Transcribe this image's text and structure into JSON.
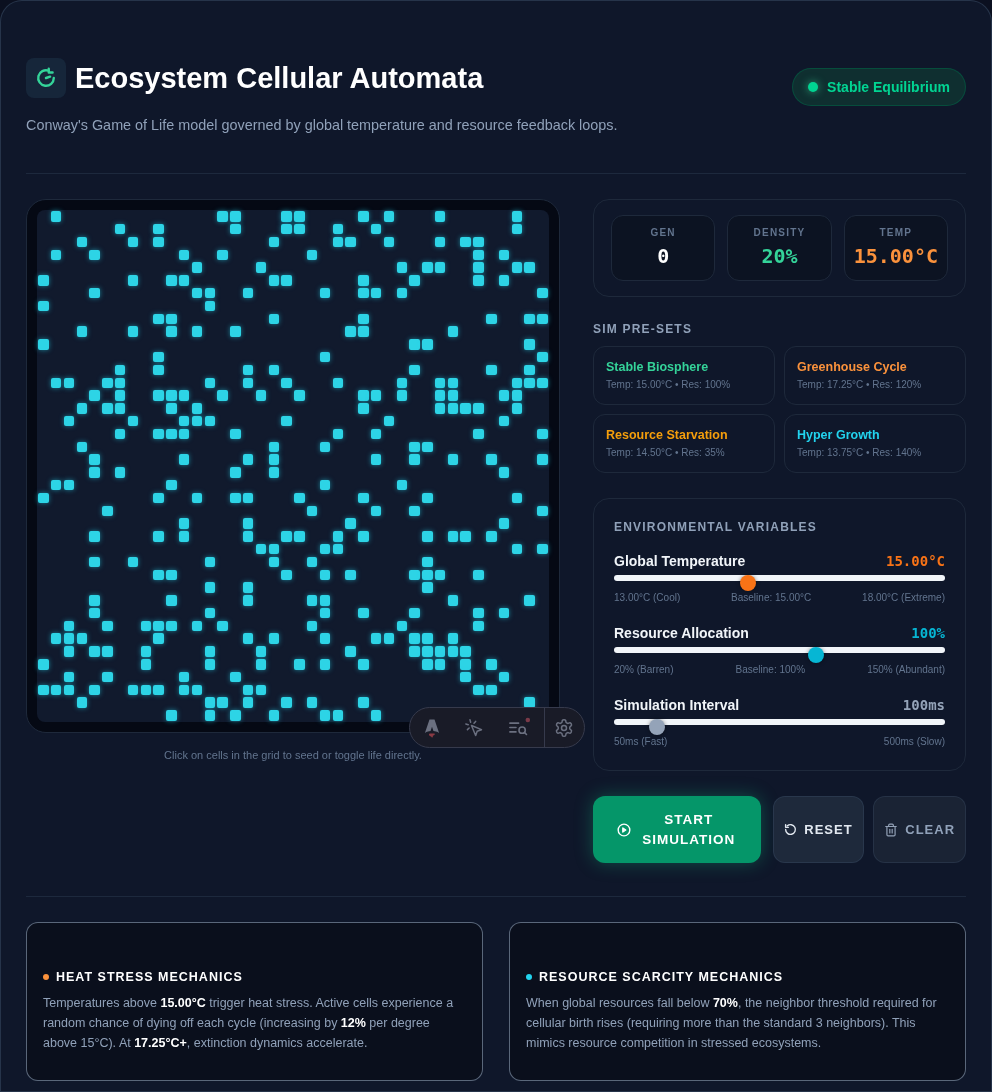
{
  "header": {
    "title": "Ecosystem Cellular Automata",
    "subtitle": "Conway's Game of Life model governed by global temperature and resource feedback loops.",
    "status_badge": {
      "label": "Stable Equilibrium"
    }
  },
  "grid": {
    "rows": [
      [
        false,
        true,
        false,
        false,
        false,
        false,
        false,
        false,
        false,
        false,
        false,
        false,
        false,
        false,
        true,
        true,
        false,
        false,
        false,
        true,
        true,
        false,
        false,
        false,
        false,
        true,
        false,
        true,
        false,
        false,
        false,
        true,
        false,
        false,
        false,
        false,
        false,
        true,
        false,
        false
      ],
      [
        false,
        false,
        false,
        false,
        false,
        false,
        true,
        false,
        false,
        true,
        false,
        false,
        false,
        false,
        false,
        true,
        false,
        false,
        false,
        true,
        true,
        false,
        false,
        true,
        false,
        false,
        true,
        false,
        false,
        false,
        false,
        false,
        false,
        false,
        false,
        false,
        false,
        true,
        false,
        false
      ],
      [
        false,
        false,
        false,
        true,
        false,
        false,
        false,
        true,
        false,
        true,
        false,
        false,
        false,
        false,
        false,
        false,
        false,
        false,
        true,
        false,
        false,
        false,
        false,
        true,
        true,
        false,
        false,
        true,
        false,
        false,
        false,
        true,
        false,
        true,
        true,
        false,
        false,
        false,
        false,
        false
      ],
      [
        false,
        true,
        false,
        false,
        true,
        false,
        false,
        false,
        false,
        false,
        false,
        true,
        false,
        false,
        true,
        false,
        false,
        false,
        false,
        false,
        false,
        true,
        false,
        false,
        false,
        false,
        false,
        false,
        false,
        false,
        false,
        false,
        false,
        false,
        true,
        false,
        true,
        false,
        false,
        false
      ],
      [
        false,
        false,
        false,
        false,
        false,
        false,
        false,
        false,
        false,
        false,
        false,
        false,
        true,
        false,
        false,
        false,
        false,
        true,
        false,
        false,
        false,
        false,
        false,
        false,
        false,
        false,
        false,
        false,
        true,
        false,
        true,
        true,
        false,
        false,
        true,
        false,
        false,
        true,
        true,
        false
      ],
      [
        true,
        false,
        false,
        false,
        false,
        false,
        false,
        true,
        false,
        false,
        true,
        true,
        false,
        false,
        false,
        false,
        false,
        false,
        true,
        true,
        false,
        false,
        false,
        false,
        false,
        true,
        false,
        false,
        false,
        true,
        false,
        false,
        false,
        false,
        true,
        false,
        true,
        false,
        false,
        false
      ],
      [
        false,
        false,
        false,
        false,
        true,
        false,
        false,
        false,
        false,
        false,
        false,
        false,
        true,
        true,
        false,
        false,
        true,
        false,
        false,
        false,
        false,
        false,
        true,
        false,
        false,
        true,
        true,
        false,
        true,
        false,
        false,
        false,
        false,
        false,
        false,
        false,
        false,
        false,
        false,
        true
      ],
      [
        true,
        false,
        false,
        false,
        false,
        false,
        false,
        false,
        false,
        false,
        false,
        false,
        false,
        true,
        false,
        false,
        false,
        false,
        false,
        false,
        false,
        false,
        false,
        false,
        false,
        false,
        false,
        false,
        false,
        false,
        false,
        false,
        false,
        false,
        false,
        false,
        false,
        false,
        false,
        false
      ],
      [
        false,
        false,
        false,
        false,
        false,
        false,
        false,
        false,
        false,
        true,
        true,
        false,
        false,
        false,
        false,
        false,
        false,
        false,
        true,
        false,
        false,
        false,
        false,
        false,
        false,
        true,
        false,
        false,
        false,
        false,
        false,
        false,
        false,
        false,
        false,
        true,
        false,
        false,
        true,
        true
      ],
      [
        false,
        false,
        false,
        true,
        false,
        false,
        false,
        true,
        false,
        false,
        true,
        false,
        true,
        false,
        false,
        true,
        false,
        false,
        false,
        false,
        false,
        false,
        false,
        false,
        true,
        true,
        false,
        false,
        false,
        false,
        false,
        false,
        true,
        false,
        false,
        false,
        false,
        false,
        false,
        false
      ],
      [
        true,
        false,
        false,
        false,
        false,
        false,
        false,
        false,
        false,
        false,
        false,
        false,
        false,
        false,
        false,
        false,
        false,
        false,
        false,
        false,
        false,
        false,
        false,
        false,
        false,
        false,
        false,
        false,
        false,
        true,
        true,
        false,
        false,
        false,
        false,
        false,
        false,
        false,
        true,
        false
      ],
      [
        false,
        false,
        false,
        false,
        false,
        false,
        false,
        false,
        false,
        true,
        false,
        false,
        false,
        false,
        false,
        false,
        false,
        false,
        false,
        false,
        false,
        false,
        true,
        false,
        false,
        false,
        false,
        false,
        false,
        false,
        false,
        false,
        false,
        false,
        false,
        false,
        false,
        false,
        false,
        true
      ],
      [
        false,
        false,
        false,
        false,
        false,
        false,
        true,
        false,
        false,
        true,
        false,
        false,
        false,
        false,
        false,
        false,
        true,
        false,
        true,
        false,
        false,
        false,
        false,
        false,
        false,
        false,
        false,
        false,
        false,
        true,
        false,
        false,
        false,
        false,
        false,
        true,
        false,
        false,
        true,
        false
      ],
      [
        false,
        true,
        true,
        false,
        false,
        true,
        true,
        false,
        false,
        false,
        false,
        false,
        false,
        true,
        false,
        false,
        true,
        false,
        false,
        true,
        false,
        false,
        false,
        true,
        false,
        false,
        false,
        false,
        true,
        false,
        false,
        true,
        true,
        false,
        false,
        false,
        false,
        true,
        true,
        true
      ],
      [
        false,
        false,
        false,
        false,
        true,
        false,
        true,
        false,
        false,
        true,
        true,
        true,
        false,
        false,
        true,
        false,
        false,
        true,
        false,
        false,
        true,
        false,
        false,
        false,
        false,
        true,
        true,
        false,
        true,
        false,
        false,
        true,
        true,
        false,
        false,
        false,
        true,
        true,
        false,
        false
      ],
      [
        false,
        false,
        false,
        true,
        false,
        true,
        true,
        false,
        false,
        false,
        true,
        false,
        true,
        false,
        false,
        false,
        false,
        false,
        false,
        false,
        false,
        false,
        false,
        false,
        false,
        true,
        false,
        false,
        false,
        false,
        false,
        true,
        true,
        true,
        true,
        false,
        false,
        true,
        false,
        false
      ],
      [
        false,
        false,
        true,
        false,
        false,
        false,
        false,
        true,
        false,
        false,
        false,
        true,
        true,
        true,
        false,
        false,
        false,
        false,
        false,
        true,
        false,
        false,
        false,
        false,
        false,
        false,
        false,
        true,
        false,
        false,
        false,
        false,
        false,
        false,
        false,
        false,
        true,
        false,
        false,
        false
      ],
      [
        false,
        false,
        false,
        false,
        false,
        false,
        true,
        false,
        false,
        true,
        true,
        true,
        false,
        false,
        false,
        true,
        false,
        false,
        false,
        false,
        false,
        false,
        false,
        true,
        false,
        false,
        true,
        false,
        false,
        false,
        false,
        false,
        false,
        false,
        true,
        false,
        false,
        false,
        false,
        true
      ],
      [
        false,
        false,
        false,
        true,
        false,
        false,
        false,
        false,
        false,
        false,
        false,
        false,
        false,
        false,
        false,
        false,
        false,
        false,
        true,
        false,
        false,
        false,
        true,
        false,
        false,
        false,
        false,
        false,
        false,
        true,
        true,
        false,
        false,
        false,
        false,
        false,
        false,
        false,
        false,
        false
      ],
      [
        false,
        false,
        false,
        false,
        true,
        false,
        false,
        false,
        false,
        false,
        false,
        true,
        false,
        false,
        false,
        false,
        true,
        false,
        true,
        false,
        false,
        false,
        false,
        false,
        false,
        false,
        true,
        false,
        false,
        true,
        false,
        false,
        true,
        false,
        false,
        true,
        false,
        false,
        false,
        true
      ],
      [
        false,
        false,
        false,
        false,
        true,
        false,
        true,
        false,
        false,
        false,
        false,
        false,
        false,
        false,
        false,
        true,
        false,
        false,
        true,
        false,
        false,
        false,
        false,
        false,
        false,
        false,
        false,
        false,
        false,
        false,
        false,
        false,
        false,
        false,
        false,
        false,
        true,
        false,
        false,
        false
      ],
      [
        false,
        true,
        true,
        false,
        false,
        false,
        false,
        false,
        false,
        false,
        true,
        false,
        false,
        false,
        false,
        false,
        false,
        false,
        false,
        false,
        false,
        false,
        true,
        false,
        false,
        false,
        false,
        false,
        true,
        false,
        false,
        false,
        false,
        false,
        false,
        false,
        false,
        false,
        false,
        false
      ],
      [
        true,
        false,
        false,
        false,
        false,
        false,
        false,
        false,
        false,
        true,
        false,
        false,
        true,
        false,
        false,
        true,
        true,
        false,
        false,
        false,
        true,
        false,
        false,
        false,
        false,
        true,
        false,
        false,
        false,
        false,
        true,
        false,
        false,
        false,
        false,
        false,
        false,
        true,
        false,
        false
      ],
      [
        false,
        false,
        false,
        false,
        false,
        true,
        false,
        false,
        false,
        false,
        false,
        false,
        false,
        false,
        false,
        false,
        false,
        false,
        false,
        false,
        false,
        true,
        false,
        false,
        false,
        false,
        true,
        false,
        false,
        true,
        false,
        false,
        false,
        false,
        false,
        false,
        false,
        false,
        false,
        true
      ],
      [
        false,
        false,
        false,
        false,
        false,
        false,
        false,
        false,
        false,
        false,
        false,
        true,
        false,
        false,
        false,
        false,
        true,
        false,
        false,
        false,
        false,
        false,
        false,
        false,
        true,
        false,
        false,
        false,
        false,
        false,
        false,
        false,
        false,
        false,
        false,
        false,
        true,
        false,
        false,
        false
      ],
      [
        false,
        false,
        false,
        false,
        true,
        false,
        false,
        false,
        false,
        true,
        false,
        true,
        false,
        false,
        false,
        false,
        true,
        false,
        false,
        true,
        true,
        false,
        false,
        true,
        false,
        true,
        false,
        false,
        false,
        false,
        true,
        false,
        true,
        true,
        false,
        true,
        false,
        false,
        false,
        false
      ],
      [
        false,
        false,
        false,
        false,
        false,
        false,
        false,
        false,
        false,
        false,
        false,
        false,
        false,
        false,
        false,
        false,
        false,
        true,
        true,
        false,
        false,
        false,
        true,
        true,
        false,
        false,
        false,
        false,
        false,
        false,
        false,
        false,
        false,
        false,
        false,
        false,
        false,
        true,
        false,
        true
      ],
      [
        false,
        false,
        false,
        false,
        true,
        false,
        false,
        true,
        false,
        false,
        false,
        false,
        false,
        true,
        false,
        false,
        false,
        false,
        true,
        false,
        false,
        true,
        false,
        false,
        false,
        false,
        false,
        false,
        false,
        false,
        true,
        false,
        false,
        false,
        false,
        false,
        false,
        false,
        false,
        false
      ],
      [
        false,
        false,
        false,
        false,
        false,
        false,
        false,
        false,
        false,
        true,
        true,
        false,
        false,
        false,
        false,
        false,
        false,
        false,
        false,
        true,
        false,
        false,
        true,
        false,
        true,
        false,
        false,
        false,
        false,
        true,
        true,
        true,
        false,
        false,
        true,
        false,
        false,
        false,
        false,
        false
      ],
      [
        false,
        false,
        false,
        false,
        false,
        false,
        false,
        false,
        false,
        false,
        false,
        false,
        false,
        true,
        false,
        false,
        true,
        false,
        false,
        false,
        false,
        false,
        false,
        false,
        false,
        false,
        false,
        false,
        false,
        false,
        true,
        false,
        false,
        false,
        false,
        false,
        false,
        false,
        false,
        false
      ],
      [
        false,
        false,
        false,
        false,
        true,
        false,
        false,
        false,
        false,
        false,
        true,
        false,
        false,
        false,
        false,
        false,
        true,
        false,
        false,
        false,
        false,
        true,
        true,
        false,
        false,
        false,
        false,
        false,
        false,
        false,
        false,
        false,
        true,
        false,
        false,
        false,
        false,
        false,
        true,
        false
      ],
      [
        false,
        false,
        false,
        false,
        true,
        false,
        false,
        false,
        false,
        false,
        false,
        false,
        false,
        true,
        false,
        false,
        false,
        false,
        false,
        false,
        false,
        false,
        true,
        false,
        false,
        true,
        false,
        false,
        false,
        true,
        false,
        false,
        false,
        false,
        true,
        false,
        true,
        false,
        false,
        false
      ],
      [
        false,
        false,
        true,
        false,
        false,
        true,
        false,
        false,
        true,
        true,
        true,
        false,
        true,
        false,
        true,
        false,
        false,
        false,
        false,
        false,
        false,
        true,
        false,
        false,
        false,
        false,
        false,
        false,
        true,
        false,
        false,
        false,
        false,
        false,
        true,
        false,
        false,
        false,
        false,
        false
      ],
      [
        false,
        true,
        true,
        true,
        false,
        false,
        false,
        false,
        false,
        true,
        false,
        false,
        false,
        false,
        false,
        false,
        true,
        false,
        true,
        false,
        false,
        false,
        true,
        false,
        false,
        false,
        true,
        true,
        false,
        true,
        true,
        false,
        true,
        false,
        false,
        false,
        false,
        false,
        false,
        false
      ],
      [
        false,
        false,
        true,
        false,
        true,
        true,
        false,
        false,
        true,
        false,
        false,
        false,
        false,
        true,
        false,
        false,
        false,
        true,
        false,
        false,
        false,
        false,
        false,
        false,
        true,
        false,
        false,
        false,
        false,
        true,
        true,
        true,
        true,
        true,
        false,
        false,
        false,
        false,
        false,
        false
      ],
      [
        true,
        false,
        false,
        false,
        false,
        false,
        false,
        false,
        true,
        false,
        false,
        false,
        false,
        true,
        false,
        false,
        false,
        true,
        false,
        false,
        true,
        false,
        true,
        false,
        false,
        true,
        false,
        false,
        false,
        false,
        true,
        true,
        false,
        true,
        false,
        true,
        false,
        false,
        false,
        false
      ],
      [
        false,
        false,
        true,
        false,
        false,
        true,
        false,
        false,
        false,
        false,
        false,
        true,
        false,
        false,
        false,
        true,
        false,
        false,
        false,
        false,
        false,
        false,
        false,
        false,
        false,
        false,
        false,
        false,
        false,
        false,
        false,
        false,
        false,
        true,
        false,
        false,
        true,
        false,
        false,
        false
      ],
      [
        true,
        true,
        true,
        false,
        true,
        false,
        false,
        true,
        true,
        true,
        false,
        true,
        true,
        false,
        false,
        false,
        true,
        true,
        false,
        false,
        false,
        false,
        false,
        false,
        false,
        false,
        false,
        false,
        false,
        false,
        false,
        false,
        false,
        false,
        true,
        true,
        false,
        false,
        false,
        false
      ],
      [
        false,
        false,
        false,
        true,
        false,
        false,
        false,
        false,
        false,
        false,
        false,
        false,
        false,
        true,
        true,
        false,
        true,
        false,
        false,
        true,
        false,
        true,
        false,
        false,
        false,
        true,
        false,
        false,
        false,
        false,
        false,
        false,
        false,
        false,
        false,
        false,
        false,
        false,
        true,
        false
      ],
      [
        false,
        false,
        false,
        false,
        false,
        false,
        false,
        false,
        false,
        false,
        true,
        false,
        false,
        true,
        false,
        true,
        false,
        false,
        true,
        false,
        false,
        false,
        true,
        true,
        false,
        false,
        true,
        false,
        false,
        false,
        false,
        false,
        false,
        false,
        false,
        false,
        false,
        false,
        false,
        false
      ]
    ],
    "caption": "Click on cells in the grid to seed or toggle life directly."
  },
  "stats": [
    {
      "label": "GEN",
      "value": "0",
      "color": "#ffffff"
    },
    {
      "label": "DENSITY",
      "value": "20%",
      "color": "#34d399"
    },
    {
      "label": "TEMP",
      "value": "15.00°C",
      "color": "#fb923c"
    }
  ],
  "presets": {
    "heading": "SIM PRE-SETS",
    "items": [
      {
        "name": "Stable Biosphere",
        "detail": "Temp: 15.00°C • Res: 100%",
        "color": "#34d399"
      },
      {
        "name": "Greenhouse Cycle",
        "detail": "Temp: 17.25°C • Res: 120%",
        "color": "#fb923c"
      },
      {
        "name": "Resource Starvation",
        "detail": "Temp: 14.50°C • Res: 35%",
        "color": "#f59e0b"
      },
      {
        "name": "Hyper Growth",
        "detail": "Temp: 13.75°C • Res: 140%",
        "color": "#22d3ee"
      }
    ]
  },
  "environment": {
    "heading": "ENVIRONMENTAL VARIABLES",
    "sliders": [
      {
        "label": "Global Temperature",
        "reading": "15.00°C",
        "level": 0.4,
        "color": "#f97316",
        "ticks": [
          "13.00°C (Cool)",
          "Baseline: 15.00°C",
          "18.00°C (Extreme)"
        ]
      },
      {
        "label": "Resource Allocation",
        "reading": "100%",
        "level": 0.615,
        "color": "#06b6d4",
        "ticks": [
          "20% (Barren)",
          "Baseline: 100%",
          "150% (Abundant)"
        ]
      },
      {
        "label": "Simulation Interval",
        "reading": "100ms",
        "level": 0.111,
        "color": "#94a3b8",
        "ticks": [
          "50ms (Fast)",
          "500ms (Slow)"
        ]
      }
    ]
  },
  "actions": [
    {
      "label": "START SIMULATION",
      "kind": "start"
    },
    {
      "label": "RESET",
      "kind": "reset"
    },
    {
      "label": "CLEAR",
      "kind": "clear"
    }
  ],
  "mechanics": [
    {
      "title": "HEAT STRESS MECHANICS",
      "color": "#fb923c",
      "text": "Temperatures above **15.00°C** trigger heat stress. Active cells experience a random chance of dying off each cycle (increasing by **12%** per degree above 15°C). At **17.25°C+**, extinction dynamics accelerate."
    },
    {
      "title": "RESOURCE SCARCITY MECHANICS",
      "color": "#22d3ee",
      "text": "When global resources fall below **70%**, the neighbor threshold required for cellular birth rises (requiring more than the standard 3 neighbors). This mimics resource competition in stressed ecosystems."
    }
  ]
}
